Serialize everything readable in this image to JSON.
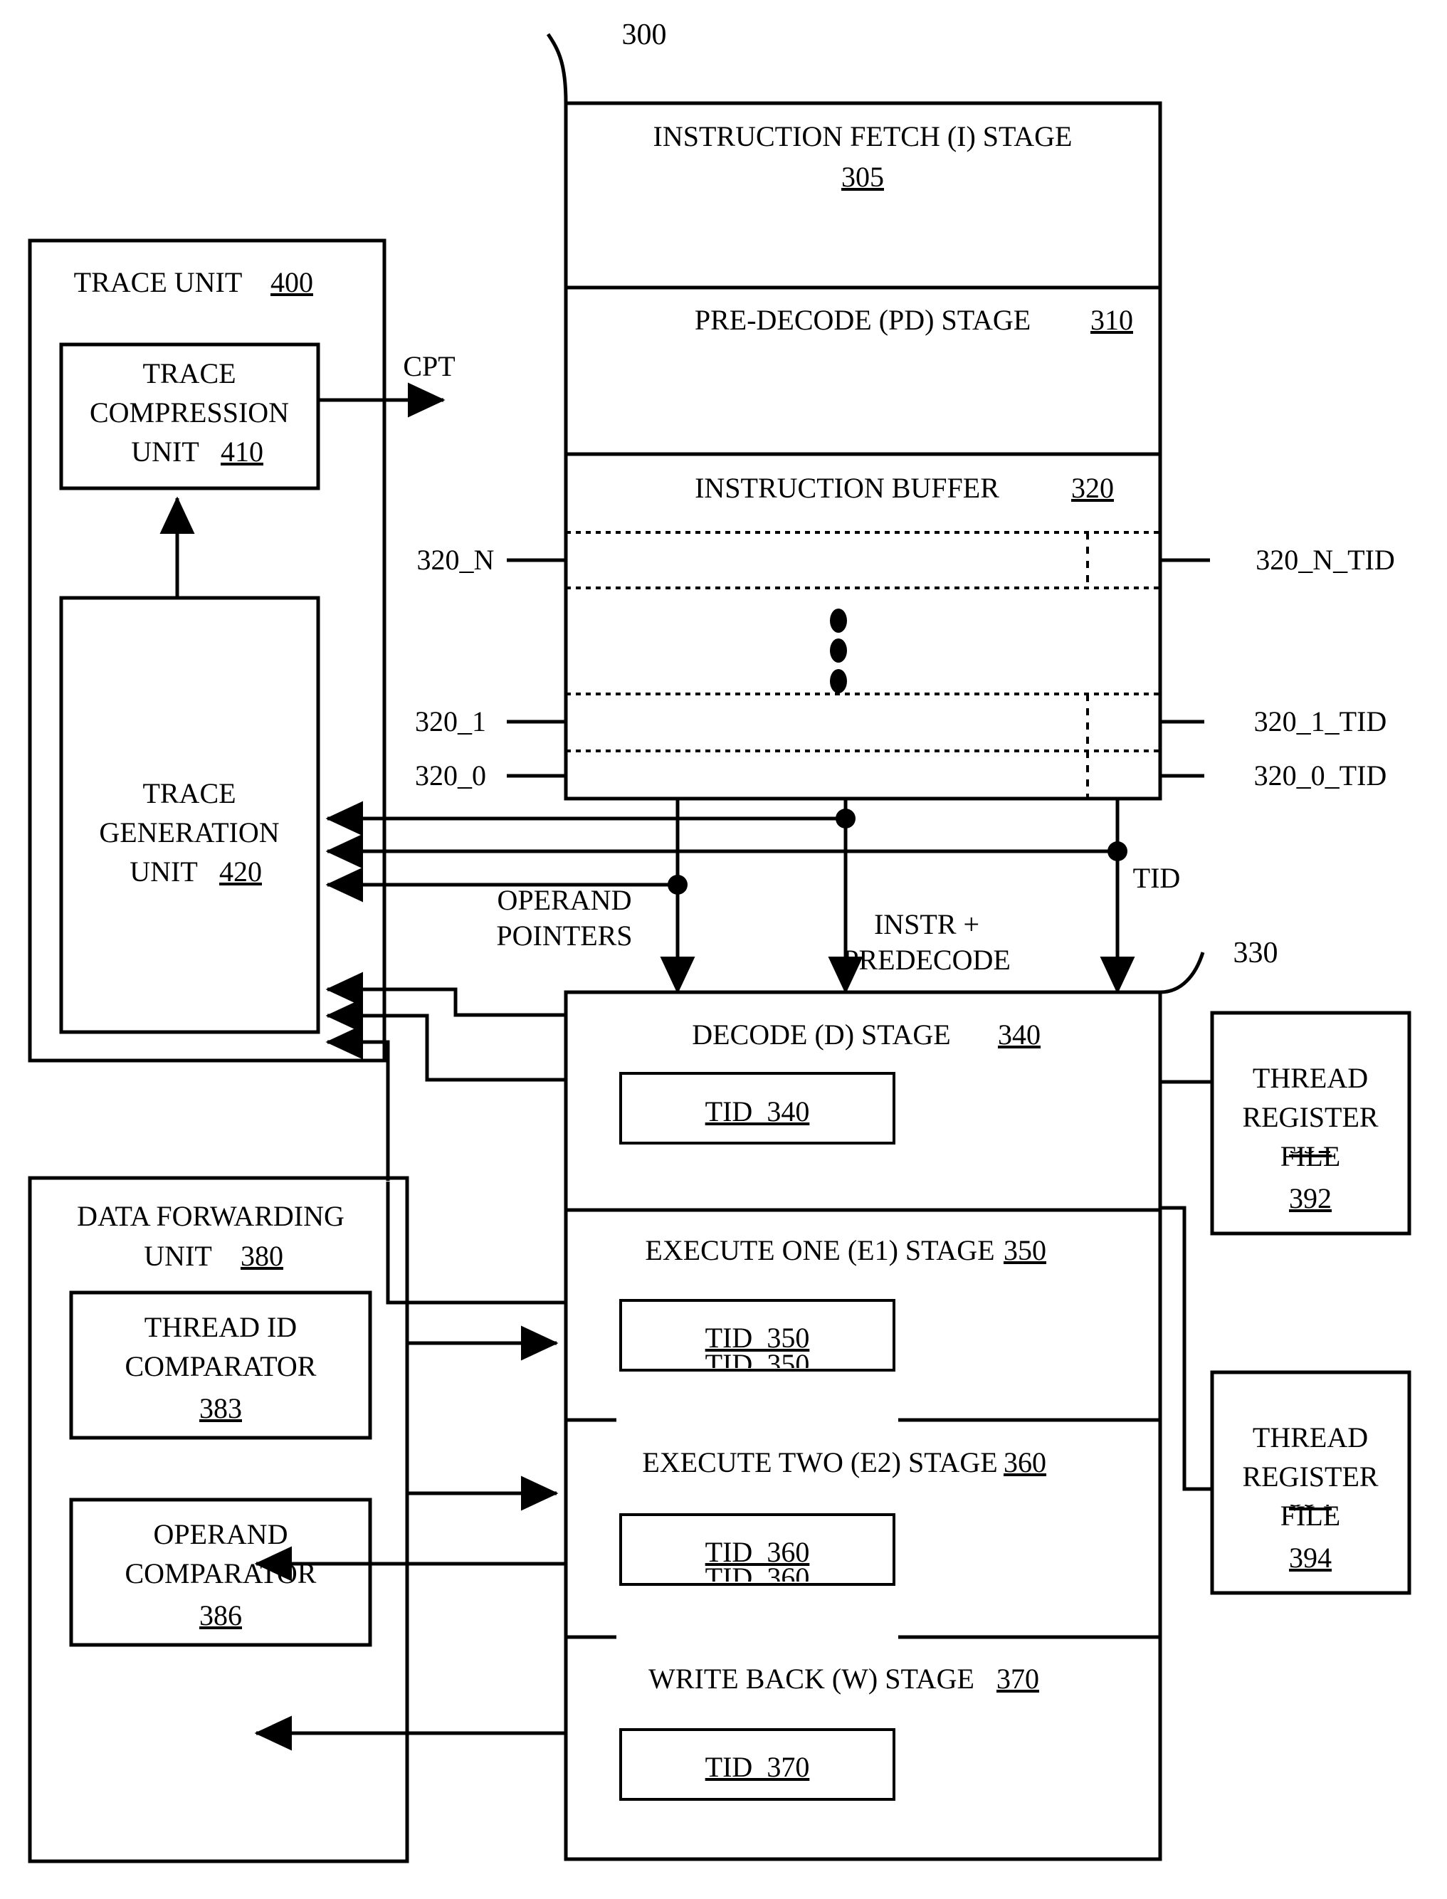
{
  "figure": {
    "ref_pipeline": "300",
    "ref_pipeline_stages_group": "330"
  },
  "pipeline": {
    "stages": [
      {
        "label": "INSTRUCTION FETCH (I) STAGE",
        "number": "305",
        "two_line": true
      },
      {
        "label": "PRE-DECODE (PD) STAGE",
        "number": "310",
        "two_line": false
      },
      {
        "label": "INSTRUCTION BUFFER",
        "number": "320",
        "two_line": false
      }
    ]
  },
  "instruction_buffer": {
    "entry_labels_left": [
      "320_N",
      "320_1",
      "320_0"
    ],
    "entry_labels_right": [
      "320_N_TID",
      "320_1_TID",
      "320_0_TID"
    ],
    "ellipsis": "vertical-dots"
  },
  "trace_unit": {
    "title": "TRACE UNIT",
    "number": "400",
    "compression": {
      "line1": "TRACE",
      "line2": "COMPRESSION",
      "line3": "UNIT",
      "number": "410"
    },
    "generation": {
      "line1": "TRACE",
      "line2": "GENERATION",
      "line3": "UNIT",
      "number": "420"
    },
    "output_signal": "CPT"
  },
  "signals": {
    "operand_pointers_line1": "OPERAND",
    "operand_pointers_line2": "POINTERS",
    "instr_predecode_line1": "INSTR +",
    "instr_predecode_line2": "PREDECODE",
    "tid": "TID"
  },
  "pipeline_stages": {
    "stages": [
      {
        "label": "DECODE (D) STAGE",
        "number": "340",
        "tid": "TID_340"
      },
      {
        "label": "EXECUTE ONE (E1) STAGE",
        "number": "350",
        "tid": "TID_350"
      },
      {
        "label": "EXECUTE TWO (E2) STAGE",
        "number": "360",
        "tid": "TID_360"
      },
      {
        "label": "WRITE BACK (W) STAGE",
        "number": "370",
        "tid": "TID_370"
      }
    ]
  },
  "data_forwarding_unit": {
    "title_line1": "DATA FORWARDING",
    "title_line2": "UNIT",
    "number": "380",
    "comparators": [
      {
        "line1": "THREAD ID",
        "line2": "COMPARATOR",
        "number": "383"
      },
      {
        "line1": "OPERAND",
        "line2": "COMPARATOR",
        "number": "386"
      }
    ]
  },
  "thread_register_files": [
    {
      "line1": "THREAD",
      "line2": "REGISTER",
      "line3": "FILE",
      "number": "392"
    },
    {
      "line1": "THREAD",
      "line2": "REGISTER",
      "line3": "FILE",
      "number": "394"
    }
  ],
  "colors": {
    "ink": "#000000",
    "paper": "#ffffff"
  }
}
